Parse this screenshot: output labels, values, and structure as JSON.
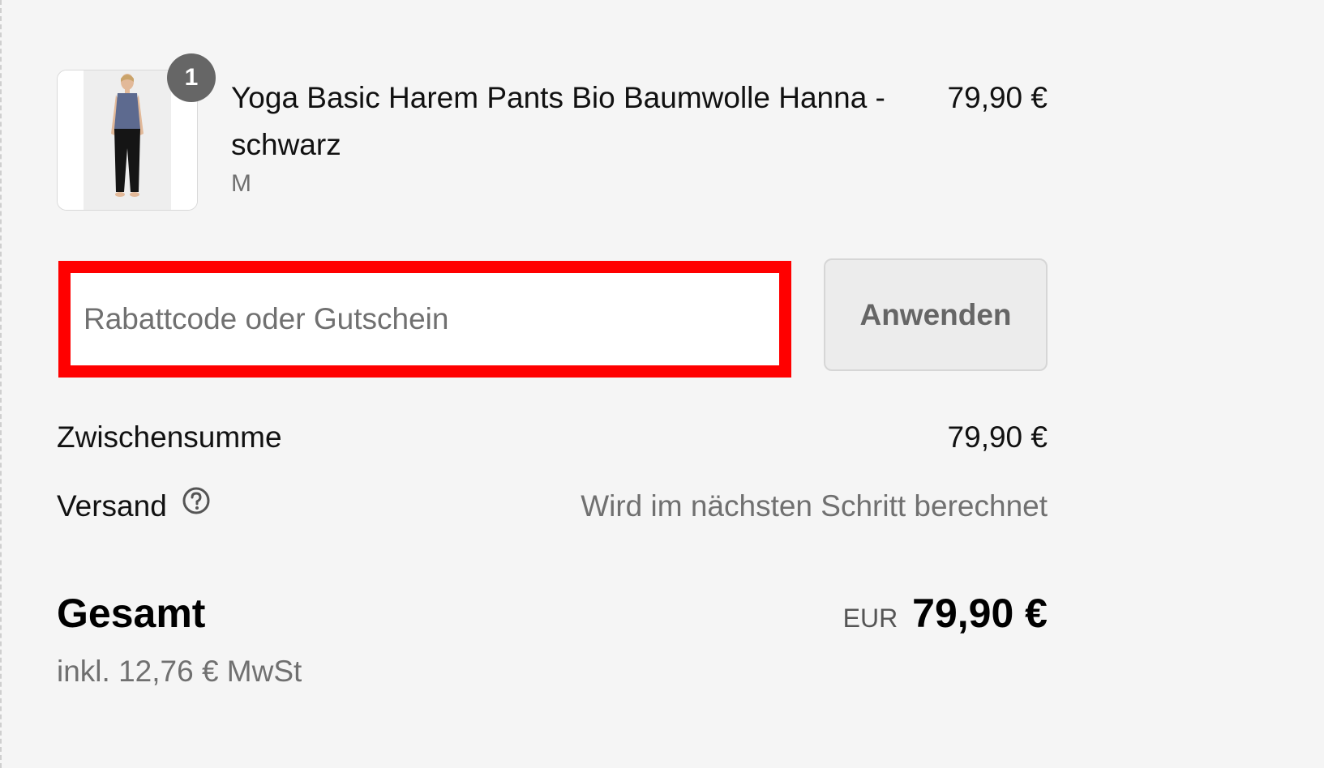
{
  "product": {
    "quantity": "1",
    "title": "Yoga Basic Harem Pants Bio Baumwolle Hanna - schwarz",
    "variant": "M",
    "price": "79,90 €",
    "image": "woman-in-tank-top-and-black-harem-pants"
  },
  "discount": {
    "placeholder": "Rabattcode oder Gutschein",
    "value": "",
    "apply_label": "Anwenden"
  },
  "summary": {
    "subtotal_label": "Zwischensumme",
    "subtotal_value": "79,90 €",
    "shipping_label": "Versand",
    "shipping_icon": "question-circle-icon",
    "shipping_value": "Wird im nächsten Schritt berechnet",
    "total_label": "Gesamt",
    "currency_code": "EUR",
    "total_value": "79,90 €",
    "tax_note": "inkl. 12,76 € MwSt"
  },
  "colors": {
    "background": "#f5f5f5",
    "badge": "#666666",
    "highlight": "#ff0000",
    "muted_text": "#707070"
  }
}
